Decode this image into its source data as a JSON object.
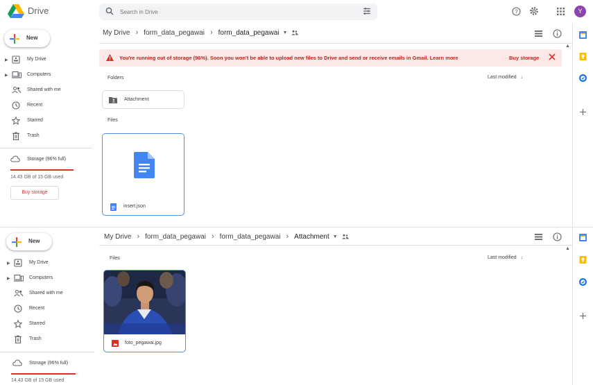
{
  "app": {
    "title": "Drive"
  },
  "search": {
    "placeholder": "Search in Drive"
  },
  "user": {
    "initial": "Y",
    "avatar_color": "#8e44ad"
  },
  "sidebar": {
    "new_label": "New",
    "items": [
      {
        "label": "My Drive",
        "icon": "my-drive-icon"
      },
      {
        "label": "Computers",
        "icon": "computers-icon"
      },
      {
        "label": "Shared with me",
        "icon": "shared-icon"
      },
      {
        "label": "Recent",
        "icon": "clock-icon"
      },
      {
        "label": "Starred",
        "icon": "star-icon"
      },
      {
        "label": "Trash",
        "icon": "trash-icon"
      }
    ],
    "storage_label": "Storage (96% full)",
    "storage_percent": 96,
    "storage_used": "14.43 GB of 15 GB used",
    "buy_storage": "Buy storage"
  },
  "view1": {
    "breadcrumb": [
      "My Drive",
      "form_data_pegawai",
      "form_data_pegawai"
    ],
    "alert": {
      "text": "You're running out of storage (96%). Soon you won't be able to upload new files to Drive and send or receive emails in Gmail.",
      "link": "Learn more",
      "action": "Buy storage"
    },
    "folders_label": "Folders",
    "sort_label": "Last modified",
    "folders": [
      {
        "name": "Attachment"
      }
    ],
    "files_label": "Files",
    "files": [
      {
        "name": "insert.json",
        "type": "google-doc"
      }
    ]
  },
  "view2": {
    "breadcrumb": [
      "My Drive",
      "form_data_pegawai",
      "form_data_pegawai",
      "Attachment"
    ],
    "files_label": "Files",
    "sort_label": "Last modified",
    "files": [
      {
        "name": "foto_pegawai.jpg",
        "type": "image"
      }
    ]
  },
  "colors": {
    "accent": "#1a73e8",
    "danger": "#d93025",
    "alert_bg": "#fce8e6"
  }
}
